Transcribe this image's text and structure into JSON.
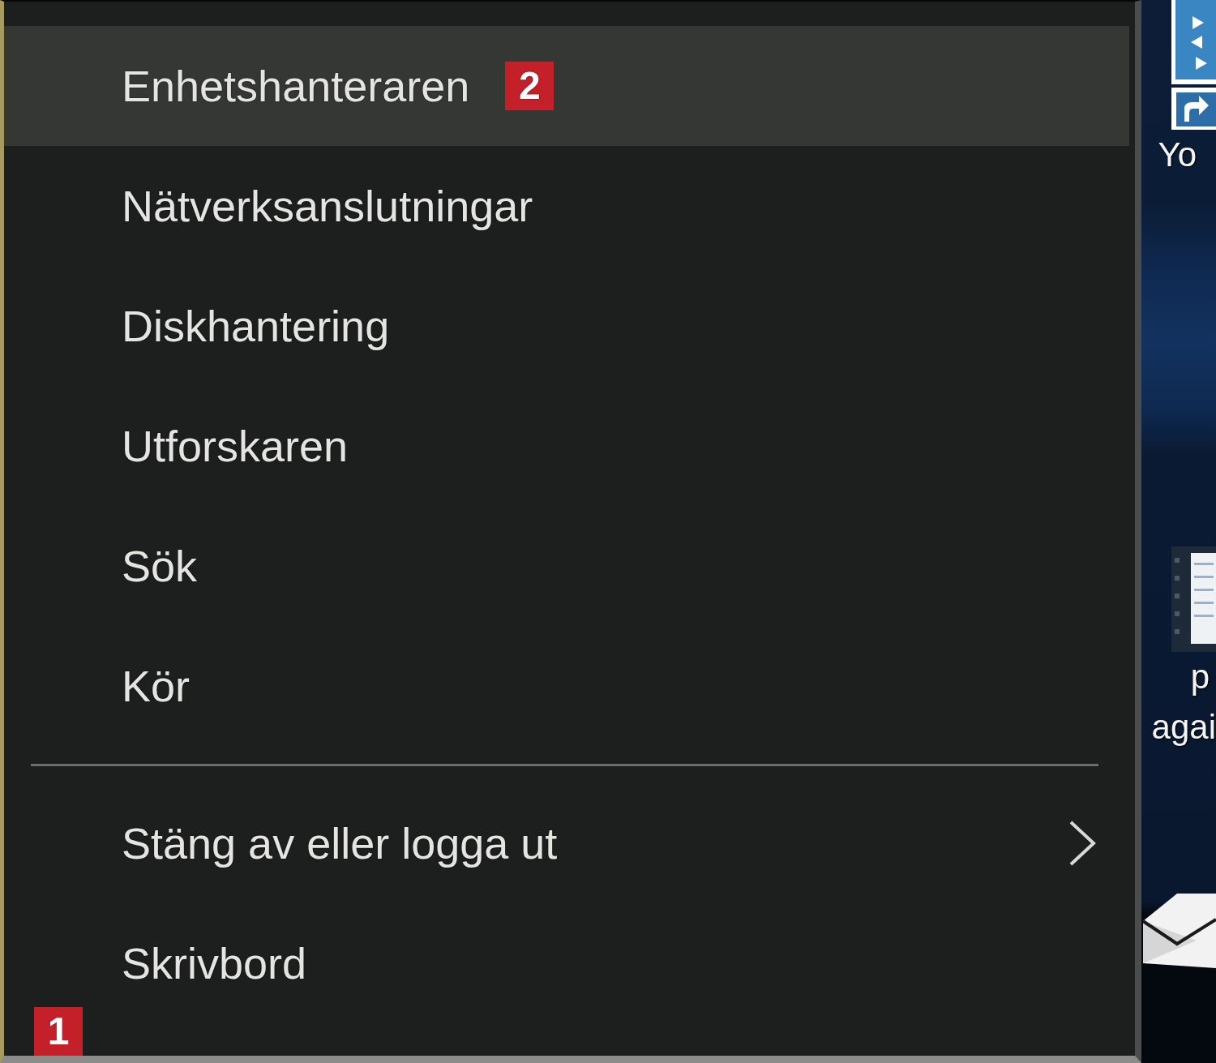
{
  "menu": {
    "items": [
      {
        "kind": "item",
        "label": "Enhetshanteraren",
        "selected": true,
        "badge": "2"
      },
      {
        "kind": "item",
        "label": "Nätverksanslutningar",
        "selected": false
      },
      {
        "kind": "item",
        "label": "Diskhantering",
        "selected": false
      },
      {
        "kind": "item",
        "label": "Utforskaren",
        "selected": false
      },
      {
        "kind": "item",
        "label": "Sök",
        "selected": false
      },
      {
        "kind": "item",
        "label": "Kör",
        "selected": false
      },
      {
        "kind": "separator"
      },
      {
        "kind": "submenu",
        "label": "Stäng av eller logga ut",
        "selected": false
      },
      {
        "kind": "item",
        "label": "Skrivbord",
        "selected": false
      }
    ],
    "corner_badge": "1"
  },
  "desktop": {
    "icons": [
      {
        "kind": "tile",
        "label_lines": [
          "Yo"
        ]
      },
      {
        "kind": "document",
        "label_lines": [
          "p",
          "agai"
        ]
      },
      {
        "kind": "envelope"
      }
    ]
  }
}
